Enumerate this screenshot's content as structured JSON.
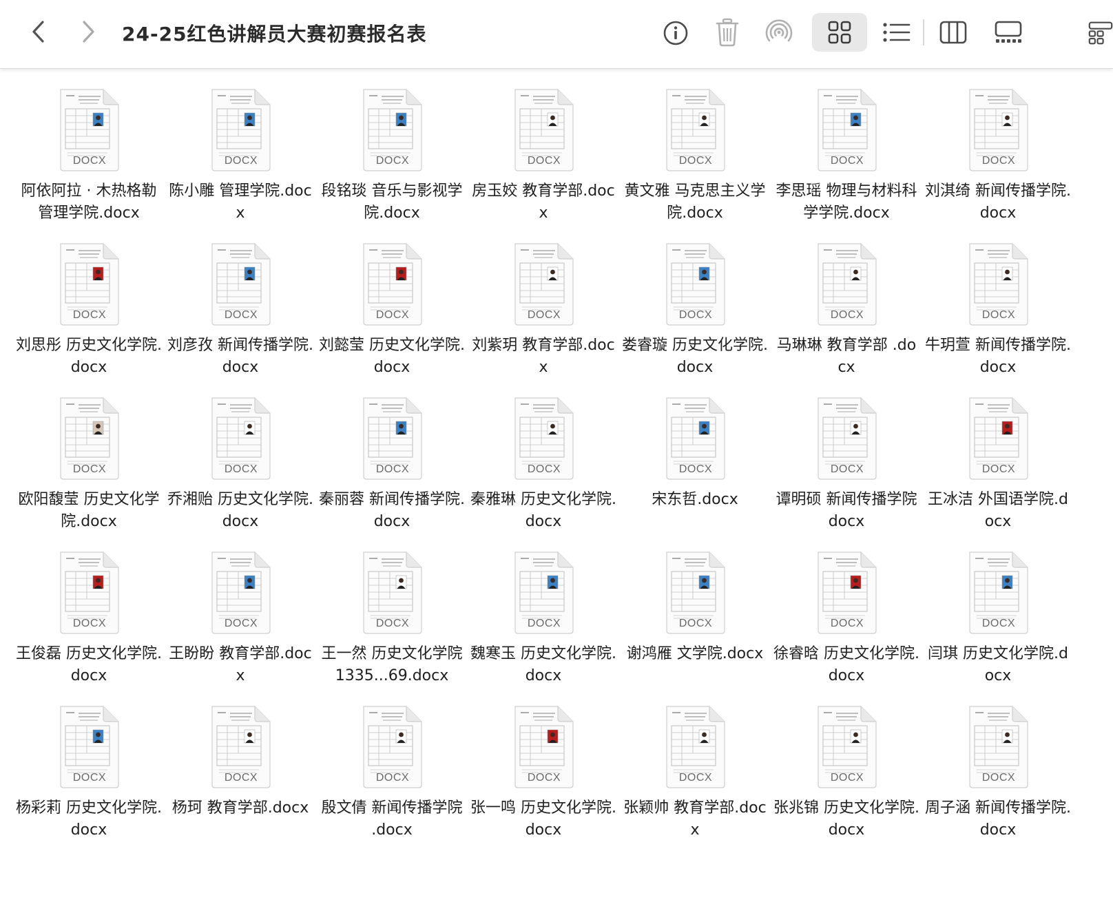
{
  "window": {
    "title": "24-25红色讲解员大赛初赛报名表"
  },
  "toolbar": {
    "view_mode_selected": "icon-grid",
    "icons": [
      "back-chevron-icon",
      "forward-chevron-icon",
      "info-icon",
      "trash-icon",
      "airdrop-icon",
      "grid-view-icon",
      "list-view-icon",
      "column-view-icon",
      "gallery-view-icon",
      "group-icon"
    ]
  },
  "thumbnail": {
    "badge": "DOCX",
    "colors": [
      "#3b82c4",
      "#3b82c4",
      "#3b82c4",
      "#ffffff",
      "#ffffff",
      "#3b82c4",
      "#ffffff",
      "#b91c1c",
      "#3b82c4",
      "#b91c1c",
      "#ffffff",
      "#3b82c4",
      "#ffffff",
      "#ffffff",
      "#d6c7b8",
      "#ffffff",
      "#3b82c4",
      "#ffffff",
      "#3b82c4",
      "#ffffff",
      "#b91c1c",
      "#b91c1c",
      "#3b82c4",
      "#ffffff",
      "#3b82c4",
      "#3b82c4",
      "#b91c1c",
      "#3b82c4",
      "#3b82c4",
      "#ffffff",
      "#ffffff",
      "#b91c1c",
      "#ffffff",
      "#ffffff",
      "#ffffff"
    ]
  },
  "files": [
    "阿依阿拉 · 木热格勒 管理学院.docx",
    "陈小雕 管理学院.docx",
    "段铭琰 音乐与影视学院.docx",
    "房玉姣 教育学部.docx",
    "黄文雅 马克思主义学院.docx",
    "李思瑶 物理与材料科学学院.docx",
    "刘淇绮 新闻传播学院.docx",
    "刘思彤 历史文化学院.docx",
    "刘彦孜 新闻传播学院.docx",
    "刘懿莹 历史文化学院.docx",
    "刘紫玥 教育学部.docx",
    "娄睿璇 历史文化学院.docx",
    "马琳琳 教育学部 .docx",
    "牛玥萱 新闻传播学院.docx",
    "欧阳馥莹 历史文化学院.docx",
    "乔湘贻 历史文化学院.docx",
    "秦丽蓉 新闻传播学院.docx",
    "秦雅琳 历史文化学院.docx",
    "宋东哲.docx",
    "谭明硕 新闻传播学院docx",
    "王冰洁 外国语学院.docx",
    "王俊磊 历史文化学院.docx",
    "王盼盼 教育学部.docx",
    "王一然 历史文化学院 1335...69.docx",
    "魏寒玉 历史文化学院.docx",
    "谢鸿雁 文学院.docx",
    "徐睿晗 历史文化学院.docx",
    "闫琪 历史文化学院.docx",
    "杨彩莉 历史文化学院.docx",
    "杨珂 教育学部.docx",
    "殷文倩 新闻传播学院 .docx",
    "张一鸣 历史文化学院.docx",
    "张颖帅 教育学部.docx",
    "张兆锦 历史文化学院.docx",
    "周子涵 新闻传播学院.docx"
  ]
}
